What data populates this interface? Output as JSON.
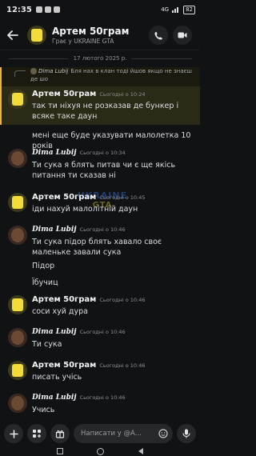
{
  "status_bar": {
    "time": "12:35",
    "battery": "82",
    "network": "4G"
  },
  "header": {
    "title": "Артем 50грам",
    "subtitle": "Грає у UKRAINE GTA"
  },
  "date_separator": "17 лютого 2025 р.",
  "reply": {
    "author": "Dima Lubij",
    "text": "Бля нах в клан тоді йшов якщо не знаєш де шо"
  },
  "messages": [
    {
      "author": "Артем 50грам",
      "timestamp": "Сьогодні о 10:24",
      "author_style": "normal",
      "lines": [
        "так ти ніхуя не розказав де бункер і всяке таке даун",
        "мені еще буде указувати малолетка 10 років"
      ]
    },
    {
      "author": "Dima Lubij",
      "timestamp": "Сьогодні о 10:34",
      "author_style": "script",
      "lines": [
        "Ти сука я блять питав чи є ще якісь питання ти сказав ні"
      ]
    },
    {
      "author": "Артем 50грам",
      "timestamp": "Сьогодні о 10:45",
      "author_style": "normal",
      "lines": [
        "іди нахуй малолітній даун"
      ]
    },
    {
      "author": "Dima Lubij",
      "timestamp": "Сьогодні о 10:46",
      "author_style": "script",
      "lines": [
        "Ти сука підор блять хавало своє маленьке завали сука",
        "Підор",
        "Їбучиц"
      ]
    },
    {
      "author": "Артем 50грам",
      "timestamp": "Сьогодні о 10:46",
      "author_style": "normal",
      "lines": [
        "соси хуй дура"
      ]
    },
    {
      "author": "Dima Lubij",
      "timestamp": "Сьогодні о 10:46",
      "author_style": "script",
      "lines": [
        "Ти сука"
      ]
    },
    {
      "author": "Артем 50грам",
      "timestamp": "Сьогодні о 10:46",
      "author_style": "normal",
      "lines": [
        "писать учісь"
      ]
    },
    {
      "author": "Dima Lubij",
      "timestamp": "Сьогодні о 10:46",
      "author_style": "script",
      "lines": [
        "Учись"
      ]
    }
  ],
  "watermark": {
    "line1": "UKRAINE",
    "line2": "GTA"
  },
  "composer": {
    "placeholder": "Написати у @А..."
  },
  "colors": {
    "background": "#111214",
    "mention_highlight": "#2b2a16",
    "mention_bar": "#f0b232",
    "accent_blue": "#3b6fd6"
  }
}
